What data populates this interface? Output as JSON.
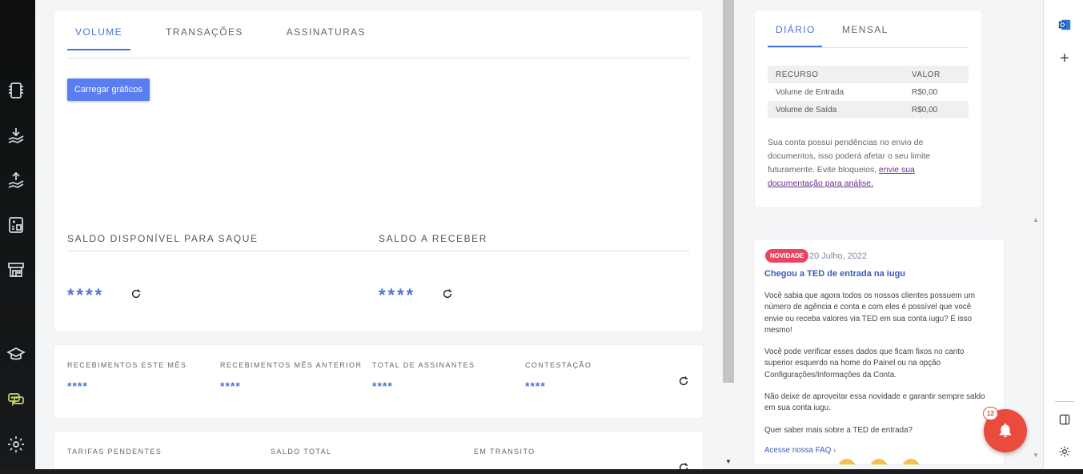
{
  "volume_card": {
    "tabs": [
      "VOLUME",
      "TRANSAÇÕES",
      "ASSINATURAS"
    ],
    "load_button": "Carregar gráficos",
    "available_balance_label": "SALDO DISPONÍVEL PARA SAQUE",
    "available_balance_value": "****",
    "receivable_label": "SALDO A RECEBER",
    "receivable_value": "****"
  },
  "stats_card": {
    "items": [
      {
        "label": "RECEBIMENTOS ESTE MÊS",
        "value": "****"
      },
      {
        "label": "RECEBIMENTOS MÊS ANTERIOR",
        "value": "****"
      },
      {
        "label": "TOTAL DE ASSINANTES",
        "value": "****"
      },
      {
        "label": "CONTESTAÇÃO",
        "value": "****"
      }
    ]
  },
  "fees_card": {
    "items": [
      {
        "label": "TARIFAS PENDENTES"
      },
      {
        "label": "SALDO TOTAL"
      },
      {
        "label": "EM TRANSITO"
      }
    ]
  },
  "limits_card": {
    "tabs": [
      "DIÁRIO",
      "MENSAL"
    ],
    "columns": [
      "RECURSO",
      "VALOR"
    ],
    "rows": [
      {
        "resource": "Volume de Entrada",
        "value": "R$0,00"
      },
      {
        "resource": "Volume de Saída",
        "value": "R$0,00"
      }
    ],
    "note": "Sua conta possui pendências no envio de documentos, isso poderá afetar o seu limite futuramente. Evite bloqueios,",
    "note_link": "envie sua documentação para análise."
  },
  "news": {
    "badge": "NOVIDADE",
    "date": "20 Julho, 2022",
    "title": "Chegou a TED de entrada na iugu",
    "paragraphs": [
      "Você sabia que agora todos os nossos clientes possuem um número de agência e conta e com eles é possível que você envie ou receba valores via TED em sua conta iugu? É isso mesmo!",
      "Você pode verificar esses dados que ficam fixos no canto superior esquerdo na home do Painel ou na opção Configurações/Informações da Conta.",
      "Não deixe de aproveitar essa novidade e garantir sempre saldo em sua conta iugu.",
      "Quer saber mais sobre a TED de entrada?"
    ],
    "link": "Acesse nossa FAQ ›"
  },
  "notifications": {
    "count": "12"
  },
  "colors": {
    "accent": "#4d73d8",
    "button": "#5b7df2",
    "badge": "#e94560",
    "bell": "#e94b3c"
  }
}
